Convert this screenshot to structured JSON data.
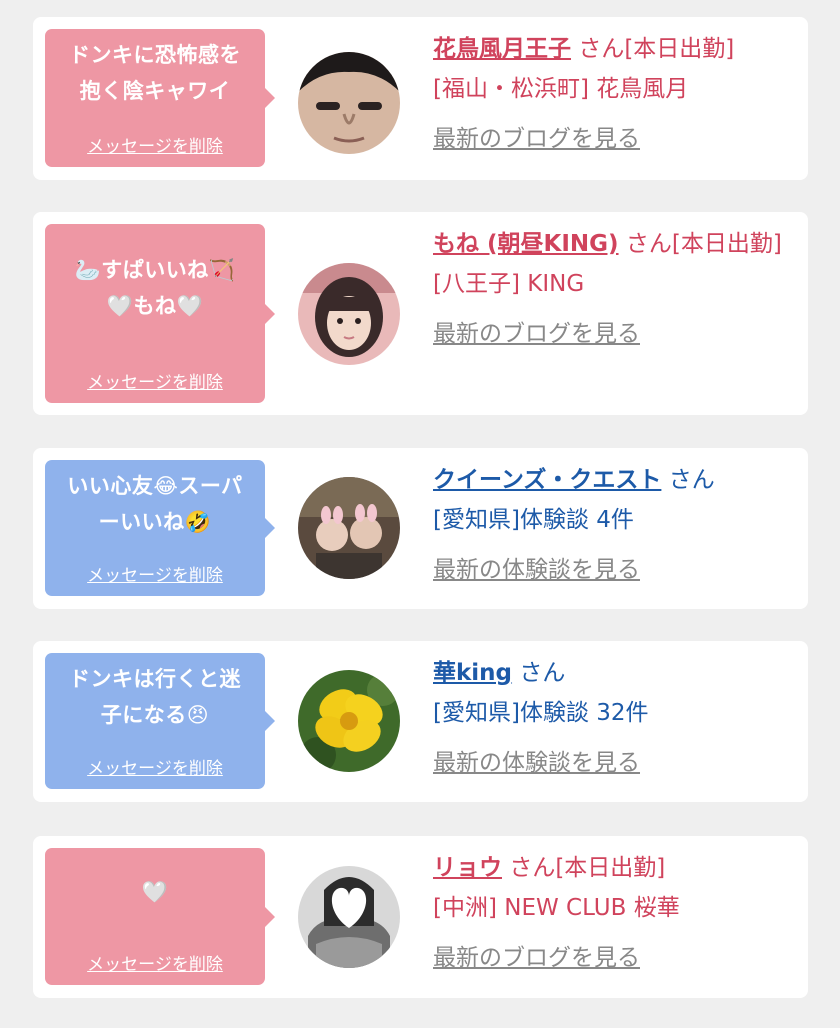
{
  "colors": {
    "pink_bubble": "#ee97a4",
    "blue_bubble": "#8fb2ec",
    "pink_text": "#d0435c",
    "blue_text": "#1d5aa8",
    "link_gray": "#888888"
  },
  "cards": [
    {
      "bubble_lines": [
        "ドンキに恐怖感を",
        "抱く陰キャワイ"
      ],
      "delete_label": "メッセージを削除",
      "name": "花鳥風月王子",
      "honorific": "さん[本日出勤]",
      "sub": "[福山・松浜町] 花鳥風月",
      "link": "最新のブログを見る",
      "avatar_icon": "man-portrait-icon"
    },
    {
      "bubble_lines": [
        "🦢すぱいいね🏹",
        "🤍もね🤍"
      ],
      "delete_label": "メッセージを削除",
      "name": "もね (朝昼KING)",
      "honorific": "さん[本日出勤]",
      "sub": "[八王子] KING",
      "link": "最新のブログを見る",
      "avatar_icon": "woman-portrait-icon"
    },
    {
      "bubble_lines": [
        "いい心友😂スーパ",
        "ーいいね🤣"
      ],
      "delete_label": "メッセージを削除",
      "name": "クイーンズ・クエスト",
      "honorific": "さん",
      "sub": "[愛知県]体験談 4件",
      "link": "最新の体験談を見る",
      "avatar_icon": "couple-photo-icon"
    },
    {
      "bubble_lines": [
        "ドンキは行くと迷",
        "子になる😠"
      ],
      "delete_label": "メッセージを削除",
      "name": "華king",
      "honorific": "さん",
      "sub": "[愛知県]体験談 32件",
      "link": "最新の体験談を見る",
      "avatar_icon": "hibiscus-flower-icon"
    },
    {
      "bubble_lines": [
        "🤍"
      ],
      "delete_label": "メッセージを削除",
      "name": "リョウ",
      "honorific": "さん[本日出勤]",
      "sub": "[中洲] NEW CLUB 桜華",
      "link": "最新のブログを見る",
      "avatar_icon": "heart-masked-portrait-icon"
    }
  ]
}
